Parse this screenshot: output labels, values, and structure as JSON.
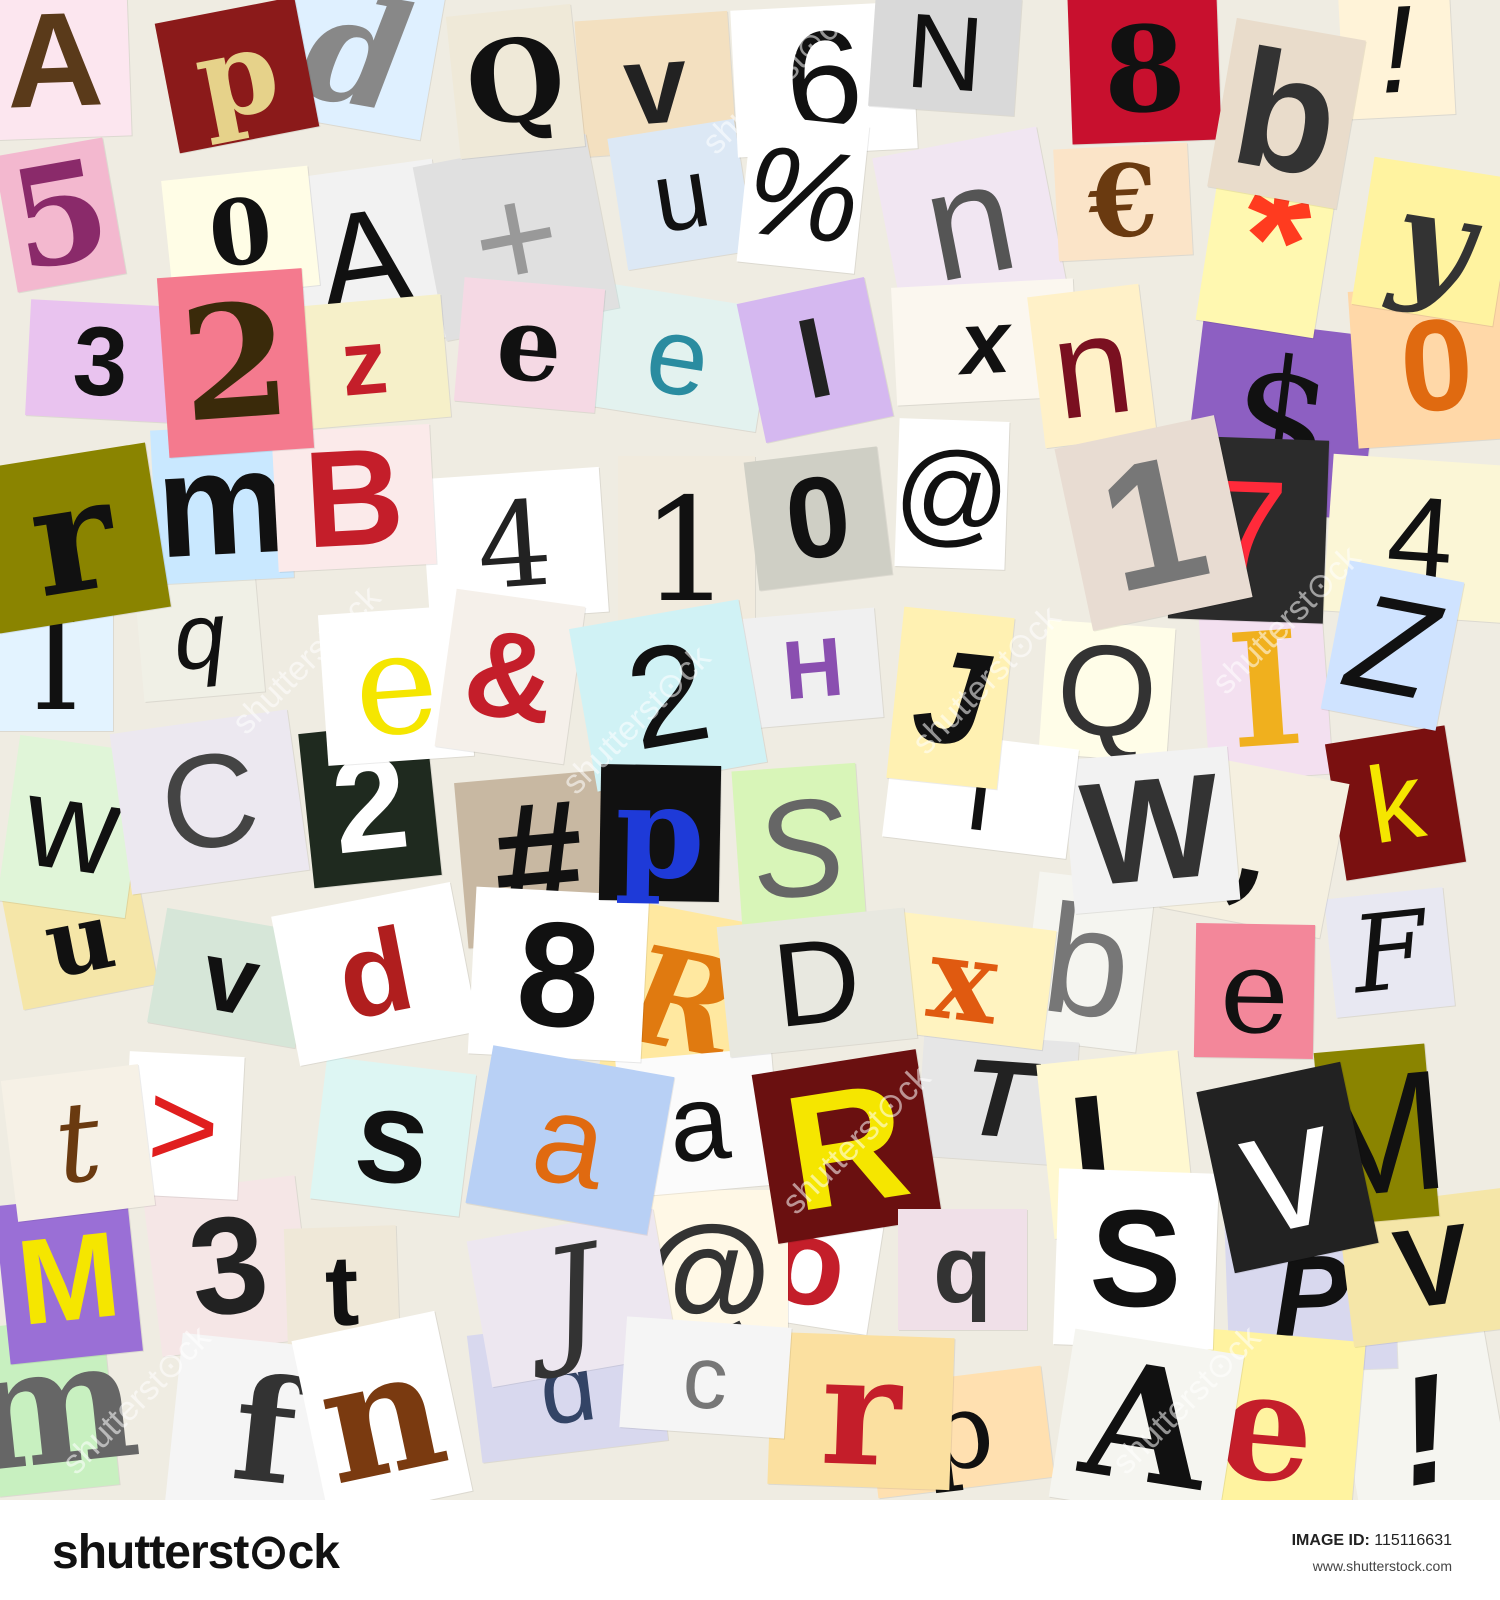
{
  "footer": {
    "logo": "shutterst⊙ck",
    "tm": "®",
    "image_id_label": "IMAGE ID:",
    "image_id": "115116631",
    "url": "www.shutterstock.com"
  },
  "watermark": "shutterst⊙ck",
  "colors": {
    "palette": [
      "#f7c6d0",
      "#c9e7f5",
      "#fff8c4",
      "#d6c7ef",
      "#cdeccd",
      "#e8e4da",
      "#f5d2b0",
      "#1f1f1f",
      "#c41e2a",
      "#8a8a00",
      "#7c3fb0",
      "#ffffff"
    ]
  },
  "glyphs": [
    {
      "ch": "A",
      "bg": "#fce6ef",
      "fg": "#5a3a1a",
      "serif": false
    },
    {
      "ch": "p",
      "bg": "#8b1a1a",
      "fg": "#e6d28a",
      "serif": true
    },
    {
      "ch": "d",
      "bg": "#dff0ff",
      "fg": "#888888",
      "serif": true
    },
    {
      "ch": "Q",
      "bg": "#efe9d8",
      "fg": "#111111",
      "serif": true
    },
    {
      "ch": "v",
      "bg": "#f3e0c0",
      "fg": "#222222",
      "serif": false
    },
    {
      "ch": "6",
      "bg": "#ffffff",
      "fg": "#111111",
      "serif": false
    },
    {
      "ch": "N",
      "bg": "#d9d9d9",
      "fg": "#111111",
      "serif": false
    },
    {
      "ch": "8",
      "bg": "#c8102e",
      "fg": "#111111",
      "serif": true
    },
    {
      "ch": "b",
      "bg": "#e9dccb",
      "fg": "#333333",
      "serif": false
    },
    {
      "ch": "!",
      "bg": "#fff3d8",
      "fg": "#111111",
      "serif": false
    },
    {
      "ch": "5",
      "bg": "#f3b8cf",
      "fg": "#8a2a6a",
      "serif": true
    },
    {
      "ch": "0",
      "bg": "#fffde6",
      "fg": "#111111",
      "serif": true
    },
    {
      "ch": "A",
      "bg": "#f2f2f2",
      "fg": "#111111",
      "serif": false
    },
    {
      "ch": "+",
      "bg": "#e0e0e0",
      "fg": "#999999",
      "serif": false
    },
    {
      "ch": "u",
      "bg": "#dce8f5",
      "fg": "#111111",
      "serif": false
    },
    {
      "ch": "%",
      "bg": "#ffffff",
      "fg": "#111111",
      "serif": false
    },
    {
      "ch": "n",
      "bg": "#f1e6f2",
      "fg": "#555555",
      "serif": false
    },
    {
      "ch": "€",
      "bg": "#fbe4c8",
      "fg": "#6a3a10",
      "serif": true
    },
    {
      "ch": "*",
      "bg": "#fff8b0",
      "fg": "#ff3b1f",
      "serif": false
    },
    {
      "ch": "y",
      "bg": "#fff3a0",
      "fg": "#333333",
      "serif": true
    },
    {
      "ch": "3",
      "bg": "#e9c3ef",
      "fg": "#111111",
      "serif": false
    },
    {
      "ch": "2",
      "bg": "#f47a8e",
      "fg": "#3a2a0a",
      "serif": true
    },
    {
      "ch": "z",
      "bg": "#f6f0c9",
      "fg": "#c41e2a",
      "serif": false
    },
    {
      "ch": "e",
      "bg": "#f5d9e4",
      "fg": "#111111",
      "serif": true
    },
    {
      "ch": "e",
      "bg": "#e3f2ef",
      "fg": "#2a8ca0",
      "serif": false
    },
    {
      "ch": "l",
      "bg": "#d5b8f0",
      "fg": "#222222",
      "serif": false
    },
    {
      "ch": "x",
      "bg": "#fbf7ef",
      "fg": "#111111",
      "serif": false
    },
    {
      "ch": "n",
      "bg": "#fff1c8",
      "fg": "#7a1020",
      "serif": false
    },
    {
      "ch": "$",
      "bg": "#8d5fc2",
      "fg": "#111111",
      "serif": true
    },
    {
      "ch": "0",
      "bg": "#ffd8a8",
      "fg": "#e06a10",
      "serif": false
    },
    {
      "ch": "r",
      "bg": "#8a8400",
      "fg": "#111111",
      "serif": true
    },
    {
      "ch": "m",
      "bg": "#c9e8ff",
      "fg": "#111111",
      "serif": false
    },
    {
      "ch": "B",
      "bg": "#fbeaea",
      "fg": "#c41e2a",
      "serif": false
    },
    {
      "ch": "4",
      "bg": "#ffffff",
      "fg": "#222222",
      "serif": true
    },
    {
      "ch": "1",
      "bg": "#f1ebde",
      "fg": "#111111",
      "serif": true
    },
    {
      "ch": "0",
      "bg": "#cfcfc5",
      "fg": "#111111",
      "serif": false
    },
    {
      "ch": "@",
      "bg": "#ffffff",
      "fg": "#111111",
      "serif": false
    },
    {
      "ch": "1",
      "bg": "#e8dcd2",
      "fg": "#777777",
      "serif": false
    },
    {
      "ch": "7",
      "bg": "#2b2b2b",
      "fg": "#ff2a3a",
      "serif": false
    },
    {
      "ch": "4",
      "bg": "#fbf6d6",
      "fg": "#111111",
      "serif": false
    },
    {
      "ch": "I",
      "bg": "#e3f3ff",
      "fg": "#111111",
      "serif": true
    },
    {
      "ch": "q",
      "bg": "#f0f0e6",
      "fg": "#111111",
      "serif": false
    },
    {
      "ch": "e",
      "bg": "#ffffff",
      "fg": "#f5e600",
      "serif": true
    },
    {
      "ch": "&",
      "bg": "#f5f0ea",
      "fg": "#c41e2a",
      "serif": false
    },
    {
      "ch": "2",
      "bg": "#d0f2f5",
      "fg": "#111111",
      "serif": false
    },
    {
      "ch": "H",
      "bg": "#f0f0f0",
      "fg": "#8a4fb0",
      "serif": false
    },
    {
      "ch": "J",
      "bg": "#fff1b2",
      "fg": "#111111",
      "serif": false
    },
    {
      "ch": "Q",
      "bg": "#fffde8",
      "fg": "#333333",
      "serif": false
    },
    {
      "ch": "I",
      "bg": "#f3e0f0",
      "fg": "#f0b01e",
      "serif": true
    },
    {
      "ch": "Z",
      "bg": "#cfe3ff",
      "fg": "#111111",
      "serif": false
    },
    {
      "ch": "w",
      "bg": "#e0f5d8",
      "fg": "#111111",
      "serif": false
    },
    {
      "ch": "C",
      "bg": "#ece8f0",
      "fg": "#444444",
      "serif": false
    },
    {
      "ch": "2",
      "bg": "#1f2a1f",
      "fg": "#ffffff",
      "serif": false
    },
    {
      "ch": "#",
      "bg": "#c8b8a2",
      "fg": "#111111",
      "serif": false
    },
    {
      "ch": "p",
      "bg": "#111111",
      "fg": "#1e3ad8",
      "serif": true
    },
    {
      "ch": "S",
      "bg": "#d8f5b8",
      "fg": "#666666",
      "serif": false
    },
    {
      "ch": "i",
      "bg": "#ffffff",
      "fg": "#111111",
      "serif": false
    },
    {
      "ch": "W",
      "bg": "#f2f2f2",
      "fg": "#333333",
      "serif": false
    },
    {
      "ch": ",",
      "bg": "#f5f0e0",
      "fg": "#111111",
      "serif": true
    },
    {
      "ch": "k",
      "bg": "#7a1010",
      "fg": "#f5e600",
      "serif": false
    },
    {
      "ch": "u",
      "bg": "#f5e6a8",
      "fg": "#111111",
      "serif": true
    },
    {
      "ch": "v",
      "bg": "#d6e6d8",
      "fg": "#111111",
      "serif": false
    },
    {
      "ch": "d",
      "bg": "#ffffff",
      "fg": "#b01e1e",
      "serif": false
    },
    {
      "ch": "8",
      "bg": "#ffffff",
      "fg": "#111111",
      "serif": false
    },
    {
      "ch": "R",
      "bg": "#ffe8a0",
      "fg": "#e07a10",
      "serif": true
    },
    {
      "ch": "D",
      "bg": "#e8e8e0",
      "fg": "#111111",
      "serif": false
    },
    {
      "ch": "x",
      "bg": "#fff3c0",
      "fg": "#e05a10",
      "serif": true
    },
    {
      "ch": "b",
      "bg": "#f5f5f0",
      "fg": "#777777",
      "serif": false
    },
    {
      "ch": "e",
      "bg": "#f3879a",
      "fg": "#111111",
      "serif": true
    },
    {
      "ch": "F",
      "bg": "#e8e8f2",
      "fg": "#111111",
      "serif": true
    },
    {
      "ch": "t",
      "bg": "#f6f1e6",
      "fg": "#6a3a10",
      "serif": true
    },
    {
      "ch": ">",
      "bg": "#ffffff",
      "fg": "#e01e1e",
      "serif": false
    },
    {
      "ch": "s",
      "bg": "#ddf6f3",
      "fg": "#111111",
      "serif": false
    },
    {
      "ch": "a",
      "bg": "#b8d0f5",
      "fg": "#e06a10",
      "serif": false
    },
    {
      "ch": "a",
      "bg": "#fbfbfb",
      "fg": "#111111",
      "serif": false
    },
    {
      "ch": "R",
      "bg": "#6a1010",
      "fg": "#f5e600",
      "serif": false
    },
    {
      "ch": "T",
      "bg": "#e6e6e6",
      "fg": "#222222",
      "serif": false
    },
    {
      "ch": "L",
      "bg": "#fff8d0",
      "fg": "#111111",
      "serif": false
    },
    {
      "ch": "v",
      "bg": "#222222",
      "fg": "#ffffff",
      "serif": false
    },
    {
      "ch": "M",
      "bg": "#8a8400",
      "fg": "#111111",
      "serif": false
    },
    {
      "ch": "M",
      "bg": "#9a6fd6",
      "fg": "#f5e600",
      "serif": false
    },
    {
      "ch": "3",
      "bg": "#f5e6e6",
      "fg": "#222222",
      "serif": false
    },
    {
      "ch": "t",
      "bg": "#efe8d8",
      "fg": "#111111",
      "serif": false
    },
    {
      "ch": "J",
      "bg": "#ede7f0",
      "fg": "#333333",
      "serif": true
    },
    {
      "ch": "@",
      "bg": "#fff8e6",
      "fg": "#333333",
      "serif": false
    },
    {
      "ch": "o",
      "bg": "#ffffff",
      "fg": "#c41e2a",
      "serif": false
    },
    {
      "ch": "q",
      "bg": "#f0e0e8",
      "fg": "#333333",
      "serif": false
    },
    {
      "ch": "S",
      "bg": "#ffffff",
      "fg": "#111111",
      "serif": false
    },
    {
      "ch": "P",
      "bg": "#d8d8ee",
      "fg": "#111111",
      "serif": false
    },
    {
      "ch": "V",
      "bg": "#f5e6a8",
      "fg": "#111111",
      "serif": false
    },
    {
      "ch": "m",
      "bg": "#c8f0c0",
      "fg": "#666666",
      "serif": true
    },
    {
      "ch": "f",
      "bg": "#f5f5f5",
      "fg": "#333333",
      "serif": true
    },
    {
      "ch": "n",
      "bg": "#ffffff",
      "fg": "#7a3a10",
      "serif": true
    },
    {
      "ch": "d",
      "bg": "#d8d8ee",
      "fg": "#334466",
      "serif": false
    },
    {
      "ch": "c",
      "bg": "#f5f5f5",
      "fg": "#777777",
      "serif": false
    },
    {
      "ch": "r",
      "bg": "#fbe0a0",
      "fg": "#c41e2a",
      "serif": true
    },
    {
      "ch": "p",
      "bg": "#ffe0b0",
      "fg": "#111111",
      "serif": true
    },
    {
      "ch": "A",
      "bg": "#f5f5f0",
      "fg": "#111111",
      "serif": true
    },
    {
      "ch": "e",
      "bg": "#fff3a0",
      "fg": "#c41e2a",
      "serif": true
    },
    {
      "ch": "!",
      "bg": "#f5f5f0",
      "fg": "#111111",
      "serif": false
    }
  ]
}
